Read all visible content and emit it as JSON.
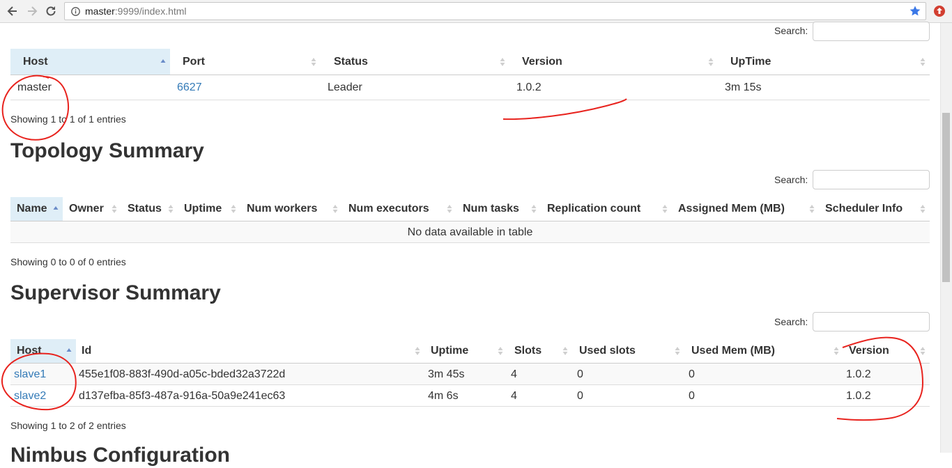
{
  "browser": {
    "url_host": "master",
    "url_rest": ":9999/index.html"
  },
  "nimbus": {
    "search_label": "Search:",
    "columns": [
      "Host",
      "Port",
      "Status",
      "Version",
      "UpTime"
    ],
    "rows": [
      {
        "host": "master",
        "port": "6627",
        "status": "Leader",
        "version": "1.0.2",
        "uptime": "3m 15s"
      }
    ],
    "info": "Showing 1 to 1 of 1 entries"
  },
  "topology": {
    "title": "Topology Summary",
    "search_label": "Search:",
    "columns": [
      "Name",
      "Owner",
      "Status",
      "Uptime",
      "Num workers",
      "Num executors",
      "Num tasks",
      "Replication count",
      "Assigned Mem (MB)",
      "Scheduler Info"
    ],
    "empty": "No data available in table",
    "info": "Showing 0 to 0 of 0 entries"
  },
  "supervisor": {
    "title": "Supervisor Summary",
    "search_label": "Search:",
    "columns": [
      "Host",
      "Id",
      "Uptime",
      "Slots",
      "Used slots",
      "Used Mem (MB)",
      "Version"
    ],
    "rows": [
      {
        "host": "slave1",
        "id": "455e1f08-883f-490d-a05c-bded32a3722d",
        "uptime": "3m 45s",
        "slots": "4",
        "used_slots": "0",
        "used_mem": "0",
        "version": "1.0.2"
      },
      {
        "host": "slave2",
        "id": "d137efba-85f3-487a-916a-50a9e241ec63",
        "uptime": "4m 6s",
        "slots": "4",
        "used_slots": "0",
        "used_mem": "0",
        "version": "1.0.2"
      }
    ],
    "info": "Showing 1 to 2 of 2 entries"
  },
  "next_section": {
    "title": "Nimbus Configuration"
  },
  "colors": {
    "link": "#337ab7",
    "sorted_header": "#dfeef7",
    "annotation": "#e8231e"
  }
}
